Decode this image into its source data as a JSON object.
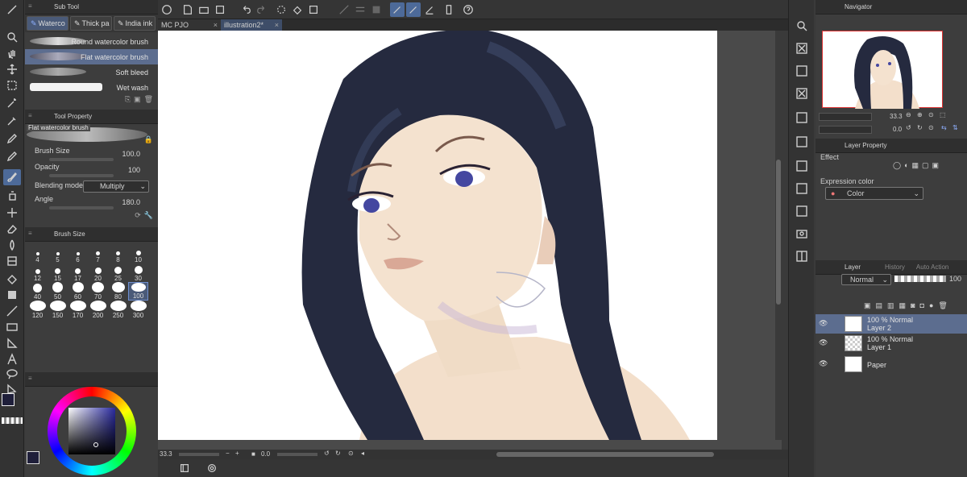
{
  "subtool": {
    "title": "Sub Tool",
    "tabs": [
      "Waterco",
      "Thick pa",
      "India ink"
    ],
    "brushes": [
      {
        "name": "Round watercolor brush",
        "selected": false
      },
      {
        "name": "Flat watercolor brush",
        "selected": true
      },
      {
        "name": "Soft bleed",
        "selected": false
      },
      {
        "name": "Wet wash",
        "selected": false
      }
    ]
  },
  "toolprop": {
    "title": "Tool Property",
    "brush_name": "Flat watercolor brush",
    "brush_size_label": "Brush Size",
    "brush_size_value": "100.0",
    "opacity_label": "Opacity",
    "opacity_value": "100",
    "blending_label": "Blending mode",
    "blending_value": "Multiply",
    "angle_label": "Angle",
    "angle_value": "180.0"
  },
  "brushsize": {
    "title": "Brush Size",
    "sizes": [
      "4",
      "5",
      "6",
      "7",
      "8",
      "10",
      "12",
      "15",
      "17",
      "20",
      "25",
      "30",
      "40",
      "50",
      "60",
      "70",
      "80",
      "100",
      "120",
      "150",
      "170",
      "200",
      "250",
      "300"
    ],
    "selected": "100"
  },
  "tabs": [
    "MC PJO",
    "illustration2*"
  ],
  "status": {
    "zoom": "33.3",
    "rotate": "0.0"
  },
  "navigator": {
    "title": "Navigator",
    "zoom": "33.3",
    "angle": "0.0"
  },
  "layerprop": {
    "title": "Layer Property",
    "effect_label": "Effect",
    "expression_label": "Expression color",
    "expression_value": "Color"
  },
  "layers": {
    "tabs": [
      "Layer",
      "History",
      "Auto Action"
    ],
    "blend_mode": "Normal",
    "opacity": "100",
    "items": [
      {
        "line1": "100 % Normal",
        "line2": "Layer 2",
        "selected": true
      },
      {
        "line1": "100 % Normal",
        "line2": "Layer 1",
        "selected": false
      },
      {
        "line1": "",
        "line2": "Paper",
        "selected": false
      }
    ]
  },
  "colors": {
    "main": "#1f1f3a",
    "sub": "#ffffff",
    "accent": "#4d6a99"
  }
}
